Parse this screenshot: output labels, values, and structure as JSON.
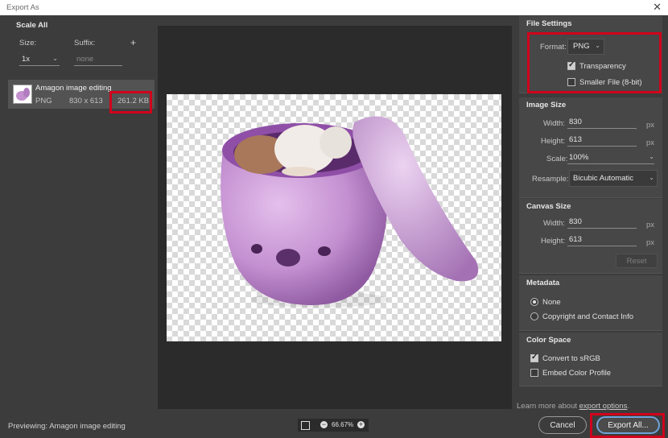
{
  "window": {
    "title": "Export As",
    "close_glyph": "✕"
  },
  "left": {
    "header": "Scale All",
    "size_label": "Size:",
    "suffix_label": "Suffix:",
    "add_glyph": "+",
    "size_value": "1x",
    "suffix_placeholder": "none",
    "item": {
      "name": "Amagon image editing",
      "format": "PNG",
      "dimensions": "830 x 613",
      "filesize": "261.2 KB"
    }
  },
  "file_settings": {
    "header": "File Settings",
    "format_label": "Format:",
    "format_value": "PNG",
    "transparency_label": "Transparency",
    "transparency_checked": true,
    "smaller_label": "Smaller File (8-bit)",
    "smaller_checked": false
  },
  "image_size": {
    "header": "Image Size",
    "width_label": "Width:",
    "width_value": "830",
    "height_label": "Height:",
    "height_value": "613",
    "scale_label": "Scale:",
    "scale_value": "100%",
    "resample_label": "Resample:",
    "resample_value": "Bicubic Automatic",
    "unit": "px"
  },
  "canvas_size": {
    "header": "Canvas Size",
    "width_label": "Width:",
    "width_value": "830",
    "height_label": "Height:",
    "height_value": "613",
    "unit": "px",
    "reset_label": "Reset"
  },
  "metadata": {
    "header": "Metadata",
    "none_label": "None",
    "copyright_label": "Copyright and Contact Info",
    "selected": "None"
  },
  "color_space": {
    "header": "Color Space",
    "convert_label": "Convert to sRGB",
    "convert_checked": true,
    "embed_label": "Embed Color Profile",
    "embed_checked": false
  },
  "footer": {
    "learn_prefix": "Learn more about ",
    "learn_link": "export options",
    "learn_suffix": ".",
    "previewing": "Previewing: Amagon image editing",
    "zoom": "66.67%",
    "cancel": "Cancel",
    "export_all": "Export All..."
  },
  "colors": {
    "accent_red": "#d0021b",
    "preview_object": "#c590cf"
  }
}
